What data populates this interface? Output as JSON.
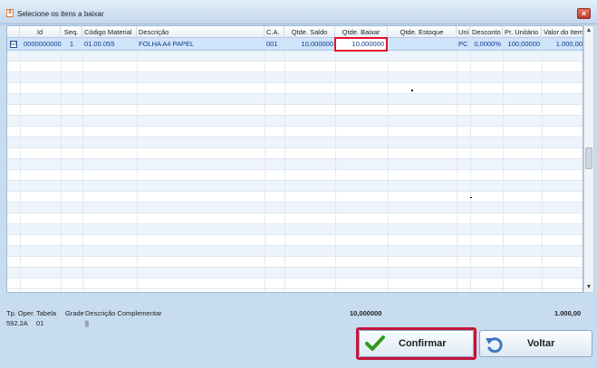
{
  "window": {
    "title": "Selecione os itens a baixar",
    "app_icon_glyph": "8",
    "close_glyph": "×",
    "close_color": "#c1392b"
  },
  "grid": {
    "columns": [
      "Id",
      "Seq.",
      "Código Material",
      "Descrição",
      "C.A.",
      "Qtde. Saldo",
      "Qtde. Baixar",
      "Qtde. Estoque",
      "Uni.",
      "Desconto",
      "Pr. Unitário",
      "Valor do Item"
    ],
    "rows": [
      {
        "checked": "☑",
        "id": "0000000000",
        "seq": "1",
        "codigo": "01.00.055",
        "descricao": "FOLHA A4 PAPEL",
        "ca": "001",
        "saldo": "10,000000",
        "baixar": "10,000000",
        "estoque": "",
        "uni": "PC",
        "desconto": "0,0000%",
        "unitario": "100,00000",
        "valor": "1.000,00"
      }
    ],
    "highlight_color": "#e0142a"
  },
  "scrollbar": {
    "up_glyph": "▲",
    "down_glyph": "▼"
  },
  "footer": {
    "label_tp_oper": "Tp. Oper.",
    "label_tabela": "Tabela",
    "label_grade": "Grade",
    "label_desc_compl": "Descrição Complementar",
    "value_tp_oper": "592.2A",
    "value_tabela": "01",
    "value_grade": "||",
    "total_qty": "10,000000",
    "total_value": "1.000,00"
  },
  "buttons": {
    "confirm_label": "Confirmar",
    "confirm_icon": "check-icon",
    "back_label": "Voltar",
    "back_icon": "undo-arrow-icon",
    "confirm_outline_color": "#c4133a"
  }
}
